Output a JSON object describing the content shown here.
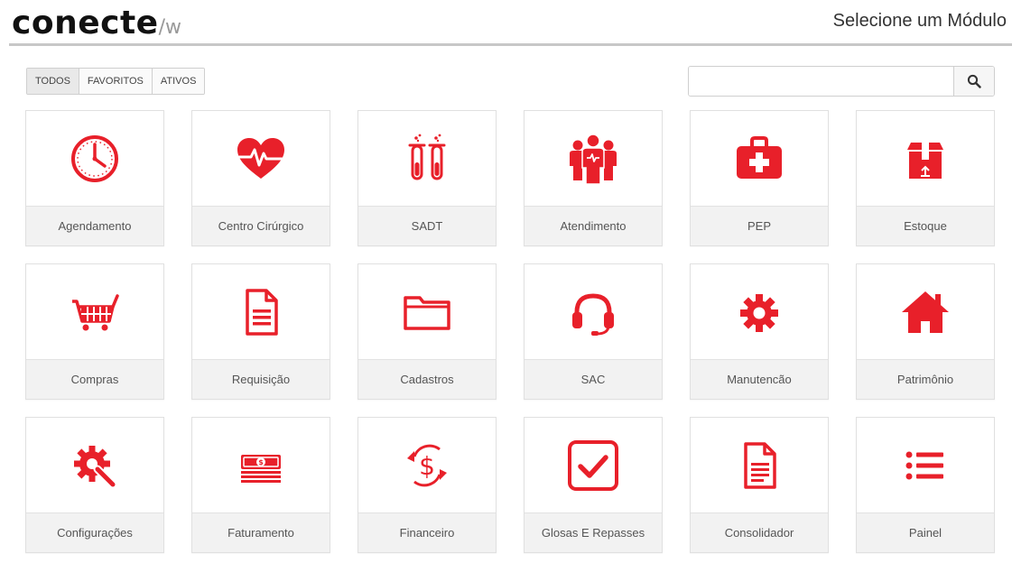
{
  "brand": {
    "name": "conecte",
    "suffix": "/w"
  },
  "header": {
    "title": "Selecione um Módulo"
  },
  "filters": [
    {
      "label": "TODOS",
      "active": true
    },
    {
      "label": "FAVORITOS",
      "active": false
    },
    {
      "label": "ATIVOS",
      "active": false
    }
  ],
  "search": {
    "value": "",
    "placeholder": "",
    "icon": "search-icon"
  },
  "accent_color": "#e8202a",
  "modules": [
    {
      "label": "Agendamento",
      "icon": "clock-icon"
    },
    {
      "label": "Centro Cirúrgico",
      "icon": "heartbeat-icon"
    },
    {
      "label": "SADT",
      "icon": "test-tubes-icon"
    },
    {
      "label": "Atendimento",
      "icon": "people-icon"
    },
    {
      "label": "PEP",
      "icon": "medical-kit-icon"
    },
    {
      "label": "Estoque",
      "icon": "package-icon"
    },
    {
      "label": "Compras",
      "icon": "shopping-cart-icon"
    },
    {
      "label": "Requisição",
      "icon": "document-icon"
    },
    {
      "label": "Cadastros",
      "icon": "folder-icon"
    },
    {
      "label": "SAC",
      "icon": "headset-icon"
    },
    {
      "label": "Manutencão",
      "icon": "gear-icon"
    },
    {
      "label": "Patrimônio",
      "icon": "home-icon"
    },
    {
      "label": "Configurações",
      "icon": "wrench-gear-icon"
    },
    {
      "label": "Faturamento",
      "icon": "money-stack-icon"
    },
    {
      "label": "Financeiro",
      "icon": "dollar-cycle-icon"
    },
    {
      "label": "Glosas E Repasses",
      "icon": "checkbox-icon"
    },
    {
      "label": "Consolidador",
      "icon": "document-outline-icon"
    },
    {
      "label": "Painel",
      "icon": "list-icon"
    }
  ]
}
